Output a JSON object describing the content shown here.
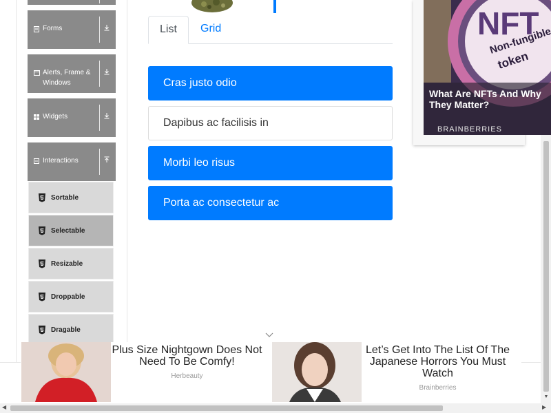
{
  "sidebar": {
    "groups": [
      {
        "label": "Forms"
      },
      {
        "label": "Alerts, Frame & Windows"
      },
      {
        "label": "Widgets"
      },
      {
        "label": "Interactions"
      }
    ],
    "items": [
      {
        "label": "Sortable"
      },
      {
        "label": "Selectable"
      },
      {
        "label": "Resizable"
      },
      {
        "label": "Droppable"
      },
      {
        "label": "Dragable"
      }
    ]
  },
  "tabs": [
    {
      "label": "List"
    },
    {
      "label": "Grid"
    }
  ],
  "list": [
    {
      "label": "Cras justo odio"
    },
    {
      "label": "Dapibus ac facilisis in"
    },
    {
      "label": "Morbi leo risus"
    },
    {
      "label": "Porta ac consectetur ac"
    }
  ],
  "right_ad": {
    "title": "What Are NFTs And Why They Matter?",
    "source": "BRAINBERRIES",
    "image_text_1": "NFT",
    "image_text_2": "Non-fungible",
    "image_text_3": "token"
  },
  "bottom_ads": [
    {
      "headline": "Plus Size Nightgown Does Not Need To Be Comfy!",
      "brand": "Herbeauty"
    },
    {
      "headline": "Let’s Get Into The List Of The Japanese Horrors You Must Watch",
      "brand": "Brainberries"
    }
  ],
  "colors": {
    "primary": "#007bff",
    "sidebar_group": "#8a8a8a",
    "sidebar_item": "#d9d9d9",
    "sidebar_item_active": "#b5b5b5"
  }
}
